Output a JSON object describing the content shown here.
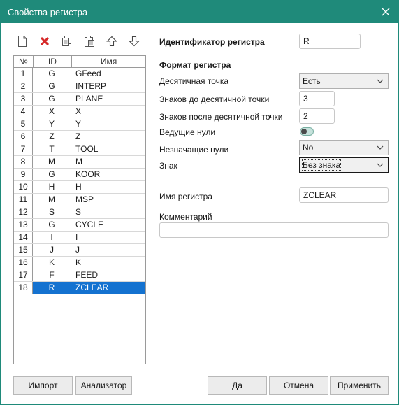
{
  "window": {
    "title": "Свойства регистра"
  },
  "toolbar": {
    "icons": [
      "new-icon",
      "delete-icon",
      "copy-icon",
      "paste-icon",
      "move-up-icon",
      "move-down-icon"
    ]
  },
  "grid": {
    "headers": [
      "№",
      "ID",
      "Имя"
    ],
    "rows": [
      {
        "num": "1",
        "id": "G",
        "name": "GFeed"
      },
      {
        "num": "2",
        "id": "G",
        "name": "INTERP"
      },
      {
        "num": "3",
        "id": "G",
        "name": "PLANE"
      },
      {
        "num": "4",
        "id": "X",
        "name": "X"
      },
      {
        "num": "5",
        "id": "Y",
        "name": "Y"
      },
      {
        "num": "6",
        "id": "Z",
        "name": "Z"
      },
      {
        "num": "7",
        "id": "T",
        "name": "TOOL"
      },
      {
        "num": "8",
        "id": "M",
        "name": "M"
      },
      {
        "num": "9",
        "id": "G",
        "name": "KOOR"
      },
      {
        "num": "10",
        "id": "H",
        "name": "H"
      },
      {
        "num": "11",
        "id": "M",
        "name": "MSP"
      },
      {
        "num": "12",
        "id": "S",
        "name": "S"
      },
      {
        "num": "13",
        "id": "G",
        "name": "CYCLE"
      },
      {
        "num": "14",
        "id": "I",
        "name": "I"
      },
      {
        "num": "15",
        "id": "J",
        "name": "J"
      },
      {
        "num": "16",
        "id": "K",
        "name": "K"
      },
      {
        "num": "17",
        "id": "F",
        "name": "FEED"
      },
      {
        "num": "18",
        "id": "R",
        "name": "ZCLEAR"
      }
    ],
    "selected_index": 17
  },
  "form": {
    "register_id_label": "Идентификатор регистра",
    "register_id_value": "R",
    "format_heading": "Формат регистра",
    "decimal_point_label": "Десятичная точка",
    "decimal_point_value": "Есть",
    "digits_before_label": "Знаков до десятичной точки",
    "digits_before_value": "3",
    "digits_after_label": "Знаков после десятичной точки",
    "digits_after_value": "2",
    "leading_zeros_label": "Ведущие нули",
    "leading_zeros_on": false,
    "trailing_zeros_label": "Незначащие нули",
    "trailing_zeros_value": "No",
    "sign_label": "Знак",
    "sign_value": "Без знака",
    "register_name_label": "Имя регистра",
    "register_name_value": "ZCLEAR",
    "comment_label": "Комментарий",
    "comment_value": ""
  },
  "buttons": {
    "import": "Импорт",
    "analyzer": "Анализатор",
    "ok": "Да",
    "cancel": "Отмена",
    "apply": "Применить"
  },
  "colors": {
    "titlebar": "#1f8a7a",
    "selection": "#1472d0",
    "delete": "#d62828"
  }
}
